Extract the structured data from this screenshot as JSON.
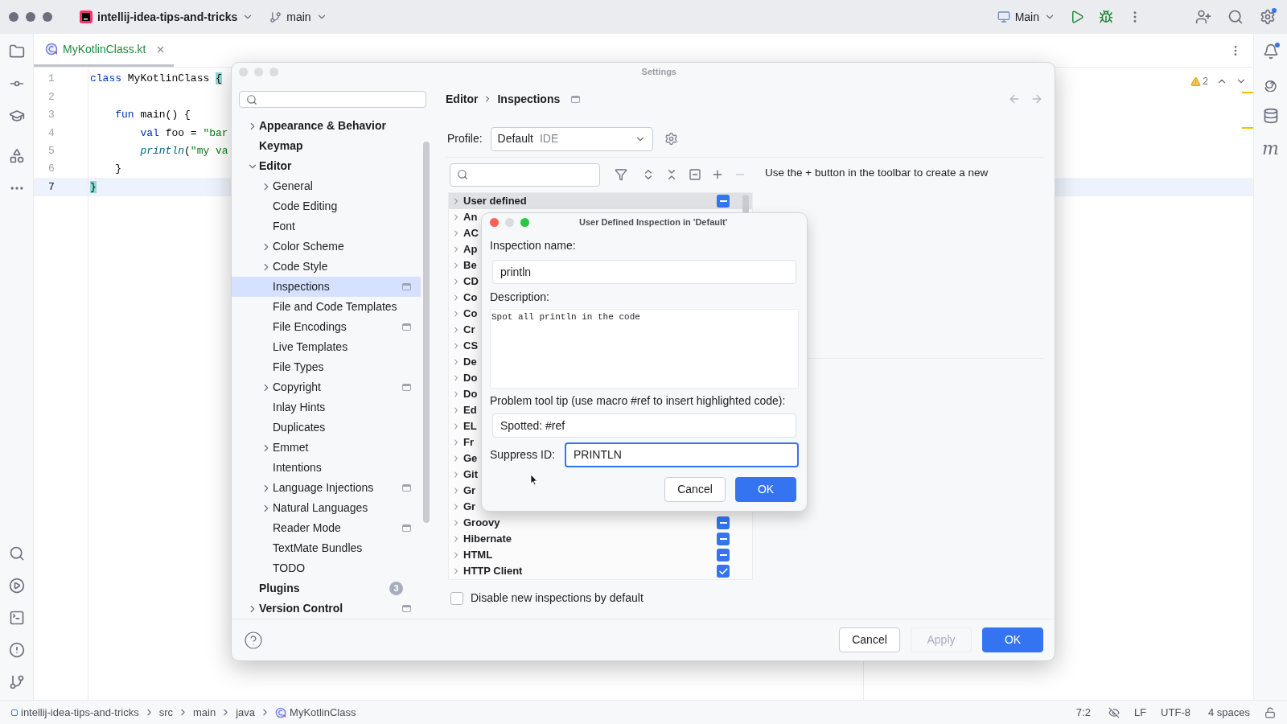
{
  "title_bar": {
    "project": "intellij-idea-tips-and-tricks",
    "branch": "main",
    "run_config": "Main"
  },
  "editor": {
    "tab": {
      "label": "MyKotlinClass.kt",
      "selected": true
    },
    "inspection_count": "2",
    "lines": [
      {
        "number": "1",
        "current": false,
        "tokens": [
          {
            "text": "class",
            "kind": "keyword"
          },
          {
            "text": " MyKotlinClass ",
            "kind": "plain"
          },
          {
            "text": "{",
            "kind": "brace"
          }
        ]
      },
      {
        "number": "2",
        "current": false
      },
      {
        "number": "3",
        "current": false,
        "tokens": [
          {
            "text": "    fun",
            "kind": "keyword"
          },
          {
            "text": " main() {",
            "kind": "plain"
          }
        ]
      },
      {
        "number": "4",
        "current": false,
        "tokens": [
          {
            "text": "        val",
            "kind": "keyword"
          },
          {
            "text": " foo = ",
            "kind": "plain"
          },
          {
            "text": "\"bar",
            "kind": "string"
          }
        ]
      },
      {
        "number": "5",
        "current": false,
        "tokens": [
          {
            "text": "        println",
            "kind": "call"
          },
          {
            "text": "(",
            "kind": "plain"
          },
          {
            "text": "\"my va",
            "kind": "string"
          }
        ]
      },
      {
        "number": "6",
        "current": false,
        "tokens": [
          {
            "text": "    }",
            "kind": "plain"
          }
        ]
      },
      {
        "number": "7",
        "current": true,
        "tokens": [
          {
            "text": "}",
            "kind": "brace"
          }
        ]
      }
    ]
  },
  "right_toolbar": {
    "letter": "m"
  },
  "settings": {
    "title": "Settings",
    "tree": [
      {
        "label": "Appearance & Behavior",
        "kind": "group",
        "expanded": false,
        "selected": false,
        "project_level": false
      },
      {
        "label": "Keymap",
        "kind": "page",
        "selected": false,
        "project_level": false
      },
      {
        "label": "Editor",
        "kind": "group",
        "expanded": true,
        "selected": false,
        "project_level": false,
        "children": [
          {
            "label": "General",
            "kind": "group",
            "expanded": false,
            "selected": false,
            "project_level": false
          },
          {
            "label": "Code Editing",
            "kind": "page",
            "selected": false,
            "project_level": false
          },
          {
            "label": "Font",
            "kind": "page",
            "selected": false,
            "project_level": false
          },
          {
            "label": "Color Scheme",
            "kind": "group",
            "expanded": false,
            "selected": false,
            "project_level": false
          },
          {
            "label": "Code Style",
            "kind": "group",
            "expanded": false,
            "selected": false,
            "project_level": false
          },
          {
            "label": "Inspections",
            "kind": "page",
            "selected": true,
            "project_level": true
          },
          {
            "label": "File and Code Templates",
            "kind": "page",
            "selected": false,
            "project_level": false
          },
          {
            "label": "File Encodings",
            "kind": "page",
            "selected": false,
            "project_level": true
          },
          {
            "label": "Live Templates",
            "kind": "page",
            "selected": false,
            "project_level": false
          },
          {
            "label": "File Types",
            "kind": "page",
            "selected": false,
            "project_level": false
          },
          {
            "label": "Copyright",
            "kind": "group",
            "expanded": false,
            "selected": false,
            "project_level": true
          },
          {
            "label": "Inlay Hints",
            "kind": "page",
            "selected": false,
            "project_level": false
          },
          {
            "label": "Duplicates",
            "kind": "page",
            "selected": false,
            "project_level": false
          },
          {
            "label": "Emmet",
            "kind": "group",
            "expanded": false,
            "selected": false,
            "project_level": false
          },
          {
            "label": "Intentions",
            "kind": "page",
            "selected": false,
            "project_level": false
          },
          {
            "label": "Language Injections",
            "kind": "group",
            "expanded": false,
            "selected": false,
            "project_level": true
          },
          {
            "label": "Natural Languages",
            "kind": "group",
            "expanded": false,
            "selected": false,
            "project_level": false
          },
          {
            "label": "Reader Mode",
            "kind": "page",
            "selected": false,
            "project_level": true
          },
          {
            "label": "TextMate Bundles",
            "kind": "page",
            "selected": false,
            "project_level": false
          },
          {
            "label": "TODO",
            "kind": "page",
            "selected": false,
            "project_level": false
          }
        ]
      },
      {
        "label": "Plugins",
        "kind": "page",
        "selected": false,
        "project_level": false,
        "badge": "3"
      },
      {
        "label": "Version Control",
        "kind": "group",
        "expanded": false,
        "selected": false,
        "project_level": true
      }
    ],
    "breadcrumb": [
      "Editor",
      "Inspections"
    ],
    "profile": {
      "label": "Profile:",
      "value": "Default",
      "scope": "IDE"
    },
    "inspections": [
      {
        "label": "User defined",
        "selected": true,
        "checked": true,
        "mixed": true
      },
      {
        "label": "An",
        "selected": false
      },
      {
        "label": "AC",
        "selected": false
      },
      {
        "label": "Ap",
        "selected": false
      },
      {
        "label": "Be",
        "selected": false
      },
      {
        "label": "CD",
        "selected": false
      },
      {
        "label": "Co",
        "selected": false
      },
      {
        "label": "Co",
        "selected": false
      },
      {
        "label": "Cr",
        "selected": false
      },
      {
        "label": "CS",
        "selected": false
      },
      {
        "label": "De",
        "selected": false
      },
      {
        "label": "Do",
        "selected": false
      },
      {
        "label": "Do",
        "selected": false
      },
      {
        "label": "Ed",
        "selected": false
      },
      {
        "label": "EL",
        "selected": false
      },
      {
        "label": "Fr",
        "selected": false
      },
      {
        "label": "Ge",
        "selected": false
      },
      {
        "label": "Git",
        "selected": false
      },
      {
        "label": "Gr",
        "selected": false
      },
      {
        "label": "Gr",
        "selected": false
      },
      {
        "label": "Groovy",
        "selected": false,
        "checked": true,
        "mixed": true
      },
      {
        "label": "Hibernate",
        "selected": false,
        "checked": true,
        "mixed": true
      },
      {
        "label": "HTML",
        "selected": false,
        "checked": true,
        "mixed": true
      },
      {
        "label": "HTTP Client",
        "selected": false,
        "checked": true,
        "mixed": false
      }
    ],
    "help_text": "Use the + button in the toolbar to create a new",
    "disable_new": {
      "label": "Disable new inspections by default",
      "checked": false
    },
    "buttons": [
      {
        "label": "Cancel",
        "kind": "plain",
        "disabled": false
      },
      {
        "label": "Apply",
        "kind": "plain",
        "disabled": true
      },
      {
        "label": "OK",
        "kind": "primary",
        "disabled": false
      }
    ]
  },
  "dialog": {
    "title": "User Defined Inspection in 'Default'",
    "fields": [
      {
        "kind": "text",
        "label": "Inspection name:",
        "value": "println",
        "focused": false
      },
      {
        "kind": "textarea",
        "label": "Description:",
        "value": "Spot all println in the code",
        "focused": false
      },
      {
        "kind": "text",
        "label": "Problem tool tip (use macro #ref to insert highlighted code):",
        "value": "Spotted: #ref",
        "focused": false
      },
      {
        "kind": "inline",
        "label": "Suppress ID:",
        "value": "PRINTLN",
        "focused": true
      }
    ],
    "buttons": [
      {
        "label": "Cancel",
        "kind": "plain",
        "disabled": false
      },
      {
        "label": "OK",
        "kind": "primary",
        "disabled": false
      }
    ]
  },
  "status_bar": {
    "path": [
      "intellij-idea-tips-and-tricks",
      "src",
      "main",
      "java",
      "MyKotlinClass"
    ],
    "position": "7:2",
    "line_separator": "LF",
    "encoding": "UTF-8",
    "indent": "4 spaces"
  }
}
